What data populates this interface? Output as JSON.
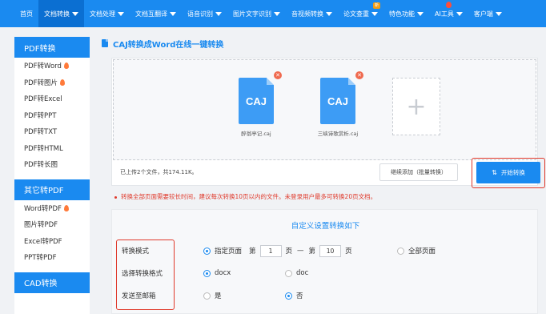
{
  "nav": {
    "items": [
      {
        "label": "首页",
        "caret": false
      },
      {
        "label": "文档转换",
        "caret": true,
        "active": true
      },
      {
        "label": "文档处理",
        "caret": true
      },
      {
        "label": "文档互翻译",
        "caret": true
      },
      {
        "label": "语音识别",
        "caret": true
      },
      {
        "label": "图片文字识别",
        "caret": true
      },
      {
        "label": "音视频转换",
        "caret": true
      },
      {
        "label": "论文查重",
        "caret": true,
        "badge": "新"
      },
      {
        "label": "特色功能",
        "caret": true
      },
      {
        "label": "AI工具",
        "caret": true,
        "flame": true
      },
      {
        "label": "客户端",
        "caret": true
      }
    ]
  },
  "sidebar": {
    "groups": [
      {
        "title": "PDF转换",
        "items": [
          {
            "label": "PDF转Word",
            "hot": true
          },
          {
            "label": "PDF转图片",
            "hot": true
          },
          {
            "label": "PDF转Excel"
          },
          {
            "label": "PDF转PPT"
          },
          {
            "label": "PDF转TXT"
          },
          {
            "label": "PDF转HTML"
          },
          {
            "label": "PDF转长图"
          }
        ]
      },
      {
        "title": "其它转PDF",
        "items": [
          {
            "label": "Word转PDF",
            "hot": true
          },
          {
            "label": "图片转PDF"
          },
          {
            "label": "Excel转PDF"
          },
          {
            "label": "PPT转PDF"
          }
        ]
      },
      {
        "title": "CAD转换",
        "items": []
      }
    ]
  },
  "page": {
    "title": "CAJ转换成Word在线一键转换"
  },
  "upload": {
    "files": [
      {
        "ext": "CAJ",
        "name": "醉翁亭记.caj"
      },
      {
        "ext": "CAJ",
        "name": "三峡诗歌赏析.caj"
      }
    ],
    "add_symbol": "+",
    "summary": "已上传2个文件，共174.11K。",
    "batch_label": "继续添加（批量转换）",
    "start_label": "开始转换"
  },
  "notice": "转换全部页面需要较长时间，建议每次转换10页以内的文件。未登录用户最多可转换20页文档。",
  "settings": {
    "title": "自定义设置转换如下",
    "rows": [
      {
        "label": "转换模式"
      },
      {
        "label": "选择转换格式"
      },
      {
        "label": "发送至邮箱"
      }
    ],
    "mode": {
      "range_label": "指定页面",
      "from_prefix": "第",
      "from_value": "1",
      "from_suffix": "页",
      "dash": "—",
      "to_prefix": "第",
      "to_value": "10",
      "to_suffix": "页",
      "all_label": "全部页面"
    },
    "format": {
      "opt1": "docx",
      "opt2": "doc"
    },
    "email": {
      "opt1": "是",
      "opt2": "否"
    }
  },
  "colors": {
    "primary": "#1a8af0",
    "highlight": "#e0392b",
    "file_icon": "#3d9cf5"
  }
}
